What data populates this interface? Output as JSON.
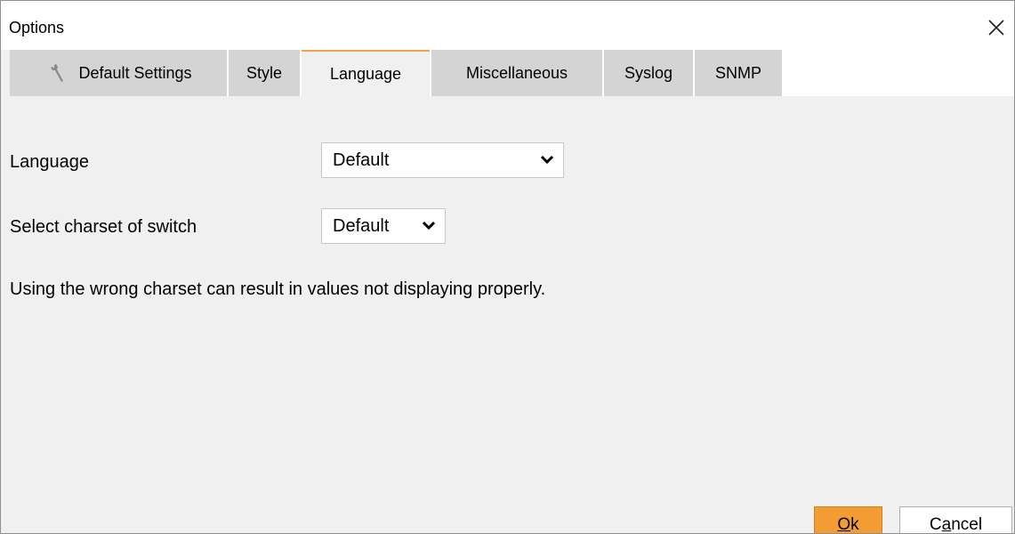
{
  "window": {
    "title": "Options"
  },
  "tabs": [
    {
      "label": "Default Settings",
      "icon": "wrench-icon"
    },
    {
      "label": "Style"
    },
    {
      "label": "Language",
      "active": true
    },
    {
      "label": "Miscellaneous"
    },
    {
      "label": "Syslog"
    },
    {
      "label": "SNMP"
    }
  ],
  "language_tab": {
    "language_label": "Language",
    "language_value": "Default",
    "charset_label": "Select charset of switch",
    "charset_value": "Default",
    "note": "Using the wrong charset can result in values not displaying properly."
  },
  "buttons": {
    "ok": {
      "mnemonic": "O",
      "rest": "k"
    },
    "cancel": {
      "before": "C",
      "mnemonic": "a",
      "after": "ncel"
    }
  },
  "colors": {
    "accent": "#f39c33",
    "tab_active_border": "#f0a44b",
    "tab_inactive": "#d4d4d4",
    "panel": "#f0f0f0"
  }
}
